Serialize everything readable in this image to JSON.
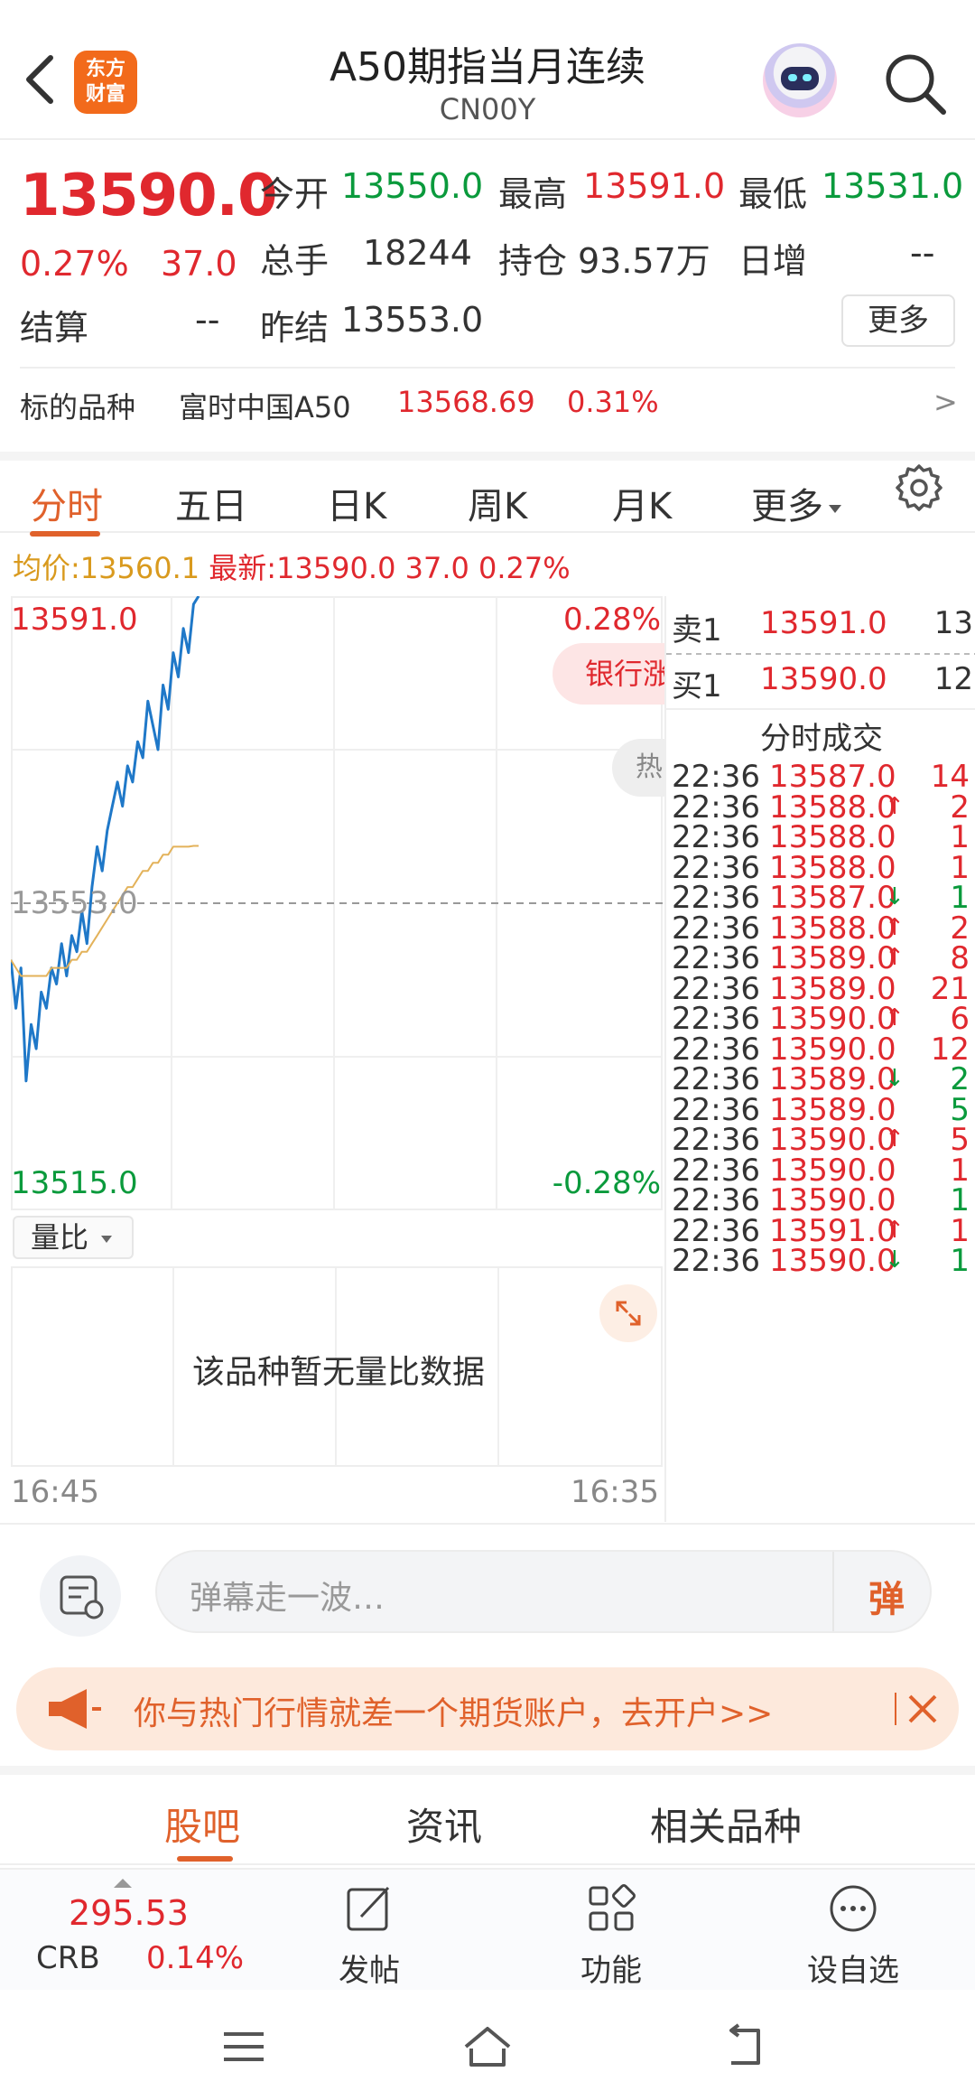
{
  "header": {
    "brand": "东方财富",
    "title": "A50期指当月连续",
    "code": "CN00Y"
  },
  "quote": {
    "price": "13590.0",
    "change_pct": "0.27%",
    "change": "37.0",
    "open_label": "今开",
    "open": "13550.0",
    "high_label": "最高",
    "high": "13591.0",
    "low_label": "最低",
    "low": "13531.0",
    "volume_label": "总手",
    "volume": "18244",
    "oi_label": "持仓",
    "oi": "93.57万",
    "daily_inc_label": "日增",
    "daily_inc": "--",
    "settle_label": "结算",
    "settle": "--",
    "prev_settle_label": "昨结",
    "prev_settle": "13553.0",
    "more_label": "更多"
  },
  "underlying": {
    "label": "标的品种",
    "name": "富时中国A50",
    "price": "13568.69",
    "pct": "0.31%",
    "arrow": ">"
  },
  "chart_tabs": [
    {
      "label": "分时",
      "active": true
    },
    {
      "label": "五日"
    },
    {
      "label": "日K"
    },
    {
      "label": "周K"
    },
    {
      "label": "月K"
    },
    {
      "label": "更多"
    }
  ],
  "avg_bar": {
    "avg_label": "均价:",
    "avg_value": "13560.1",
    "latest_label": "最新:",
    "latest_price": "13590.0",
    "latest_change": "37.0",
    "latest_pct": "0.27%"
  },
  "chart_data": {
    "type": "line",
    "y_top": "13591.0",
    "y_mid": "13553.0",
    "y_bottom": "13515.0",
    "pct_top": "0.28%",
    "pct_bottom": "-0.28%",
    "ylim": [
      13515.0,
      13591.0
    ],
    "prev_close": 13553.0,
    "series": [
      {
        "values": [
          13546,
          13540,
          13545,
          13531,
          13538,
          13535,
          13542,
          13540,
          13545,
          13543,
          13548,
          13544,
          13549,
          13547,
          13552,
          13548,
          13555,
          13560,
          13557,
          13562,
          13565,
          13568,
          13565,
          13570,
          13568,
          13573,
          13571,
          13578,
          13575,
          13572,
          13580,
          13577,
          13584,
          13581,
          13587,
          13584,
          13590,
          13591
        ]
      },
      {
        "values": [
          13546,
          13545,
          13544,
          13544,
          13544,
          13544,
          13544,
          13544,
          13545,
          13545,
          13545,
          13545,
          13546,
          13546,
          13547,
          13547,
          13548,
          13549,
          13550,
          13551,
          13552,
          13553,
          13554,
          13555,
          13555,
          13556,
          13557,
          13557,
          13558,
          13558,
          13559,
          13559,
          13560,
          13560,
          13560,
          13560,
          13560.1,
          13560.1
        ]
      }
    ],
    "overlay_buttons": [
      "银行涨",
      "热"
    ]
  },
  "volume_panel": {
    "selector_label": "量比",
    "empty_message": "该品种暂无量比数据"
  },
  "time_axis": {
    "start": "16:45",
    "end": "16:35"
  },
  "order_book": {
    "sell1_label": "卖1",
    "sell1_price": "13591.0",
    "sell1_vol": "13",
    "buy1_label": "买1",
    "buy1_price": "13590.0",
    "buy1_vol": "12",
    "ticks_title": "分时成交",
    "ticks": [
      {
        "time": "22:36",
        "price": "13587.0",
        "dir": "",
        "vol": "14",
        "vol_color": "red"
      },
      {
        "time": "22:36",
        "price": "13588.0",
        "dir": "↑",
        "vol": "2",
        "vol_color": "red"
      },
      {
        "time": "22:36",
        "price": "13588.0",
        "dir": "",
        "vol": "1",
        "vol_color": "red"
      },
      {
        "time": "22:36",
        "price": "13588.0",
        "dir": "",
        "vol": "1",
        "vol_color": "red"
      },
      {
        "time": "22:36",
        "price": "13587.0",
        "dir": "↓",
        "vol": "1",
        "vol_color": "green"
      },
      {
        "time": "22:36",
        "price": "13588.0",
        "dir": "↑",
        "vol": "2",
        "vol_color": "red"
      },
      {
        "time": "22:36",
        "price": "13589.0",
        "dir": "↑",
        "vol": "8",
        "vol_color": "red"
      },
      {
        "time": "22:36",
        "price": "13589.0",
        "dir": "",
        "vol": "21",
        "vol_color": "red"
      },
      {
        "time": "22:36",
        "price": "13590.0",
        "dir": "↑",
        "vol": "6",
        "vol_color": "red"
      },
      {
        "time": "22:36",
        "price": "13590.0",
        "dir": "",
        "vol": "12",
        "vol_color": "red"
      },
      {
        "time": "22:36",
        "price": "13589.0",
        "dir": "↓",
        "vol": "2",
        "vol_color": "green"
      },
      {
        "time": "22:36",
        "price": "13589.0",
        "dir": "",
        "vol": "5",
        "vol_color": "green"
      },
      {
        "time": "22:36",
        "price": "13590.0",
        "dir": "↑",
        "vol": "5",
        "vol_color": "red"
      },
      {
        "time": "22:36",
        "price": "13590.0",
        "dir": "",
        "vol": "1",
        "vol_color": "red"
      },
      {
        "time": "22:36",
        "price": "13590.0",
        "dir": "",
        "vol": "1",
        "vol_color": "green"
      },
      {
        "time": "22:36",
        "price": "13591.0",
        "dir": "↑",
        "vol": "1",
        "vol_color": "red"
      },
      {
        "time": "22:36",
        "price": "13590.0",
        "dir": "↓",
        "vol": "1",
        "vol_color": "green"
      }
    ]
  },
  "chat": {
    "placeholder": "弹幕走一波…",
    "danmu_label": "弹"
  },
  "banner": {
    "text": "你与热门行情就差一个期货账户，去开户>>"
  },
  "bottom_tabs": [
    {
      "label": "股吧",
      "active": true
    },
    {
      "label": "资讯"
    },
    {
      "label": "相关品种"
    }
  ],
  "toolbar": {
    "index_price": "295.53",
    "index_name": "CRB",
    "index_pct": "0.14%",
    "post_label": "发帖",
    "func_label": "功能",
    "watch_label": "设自选"
  },
  "colors": {
    "up": "#e0282e",
    "down": "#0a9a3c",
    "accent": "#e0612b",
    "price_line": "#1f78c8",
    "avg_line": "#e3b25a"
  }
}
